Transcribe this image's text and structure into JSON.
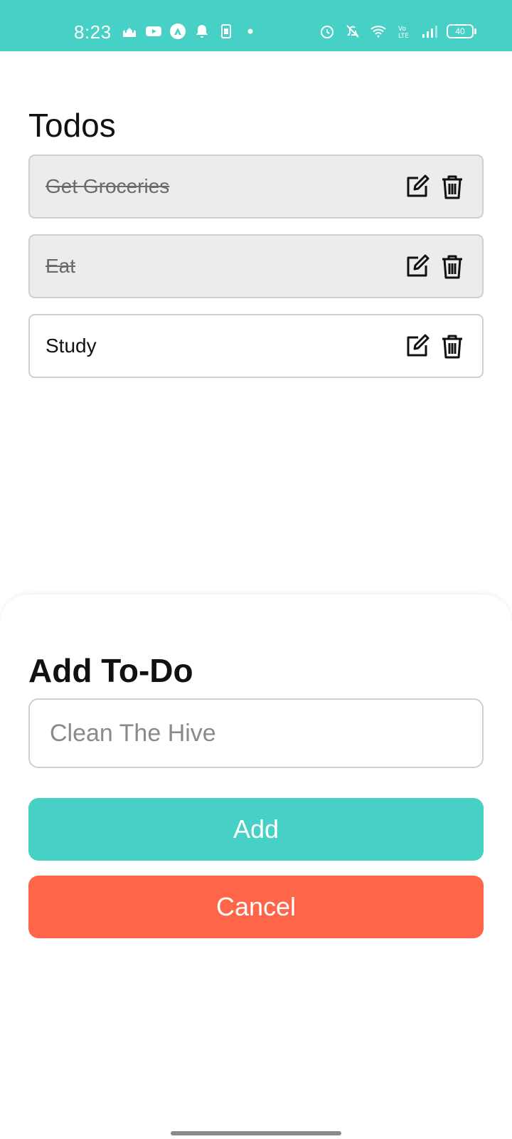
{
  "status_bar": {
    "time": "8:23",
    "battery": "40",
    "background": "#47d0c6"
  },
  "page": {
    "title": "Todos"
  },
  "todos": [
    {
      "text": "Get Groceries",
      "completed": true
    },
    {
      "text": "Eat",
      "completed": true
    },
    {
      "text": "Study",
      "completed": false
    }
  ],
  "icons": {
    "edit": "edit-icon",
    "delete": "trash-icon"
  },
  "add_sheet": {
    "title": "Add To-Do",
    "input_placeholder": "Clean The Hive",
    "input_value": "",
    "add_label": "Add",
    "cancel_label": "Cancel"
  },
  "colors": {
    "accent": "#47d0c6",
    "danger": "#ff6548",
    "completed_bg": "#ececec"
  }
}
